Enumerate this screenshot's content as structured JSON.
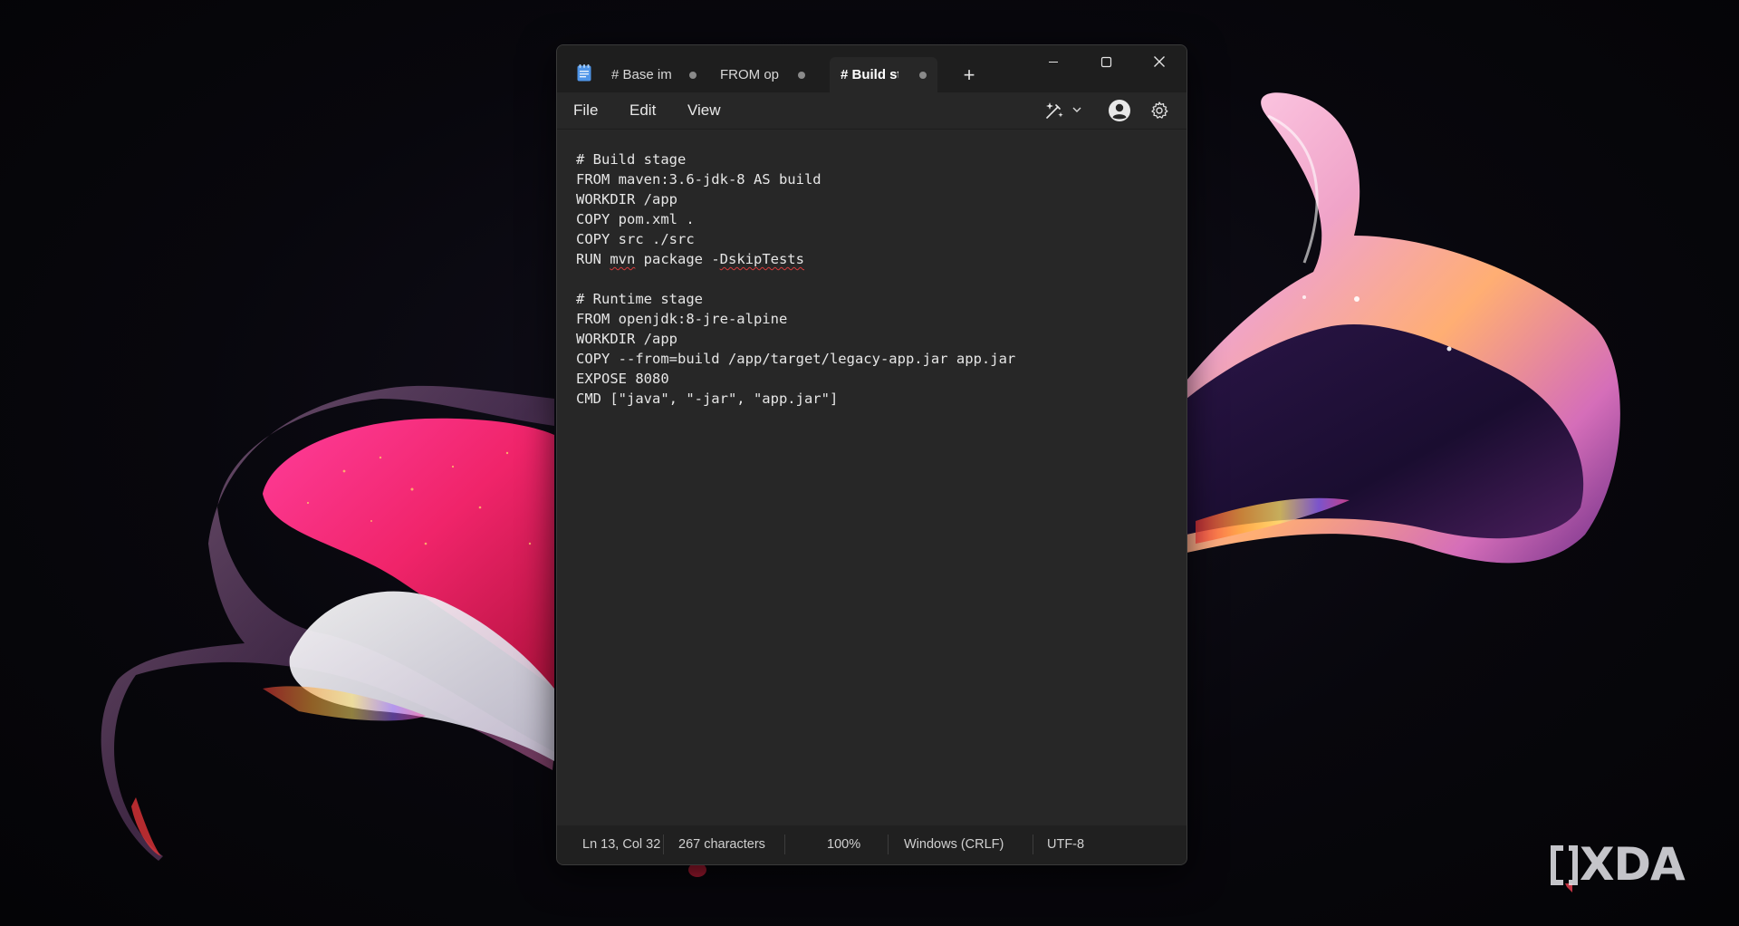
{
  "window": {
    "tabs": [
      {
        "label": "# Base im",
        "unsaved": true
      },
      {
        "label": "FROM op",
        "unsaved": true
      },
      {
        "label": "# Build st",
        "unsaved": true,
        "active": true
      }
    ],
    "new_tab_glyph": "+",
    "controls": {
      "minimize": "minimize-icon",
      "maximize": "maximize-icon",
      "close": "close-icon"
    }
  },
  "menu": {
    "file": "File",
    "edit": "Edit",
    "view": "View"
  },
  "toolbar": {
    "copilot_icon": "copilot-rewrite-icon",
    "dropdown_icon": "chevron-down-icon",
    "account_icon": "account-icon",
    "settings_icon": "settings-gear-icon"
  },
  "editor": {
    "lines": [
      {
        "text": "# Build stage"
      },
      {
        "text": "FROM maven:3.6-jdk-8 AS build"
      },
      {
        "text": "WORKDIR /app"
      },
      {
        "text": "COPY pom.xml ."
      },
      {
        "text": "COPY src ./src"
      },
      {
        "pre": "RUN ",
        "mis1": "mvn",
        "mid": " package -",
        "mis2": "DskipTests"
      },
      {
        "text": ""
      },
      {
        "text": "# Runtime stage"
      },
      {
        "text": "FROM openjdk:8-jre-alpine"
      },
      {
        "text": "WORKDIR /app"
      },
      {
        "text": "COPY --from=build /app/target/legacy-app.jar app.jar"
      },
      {
        "text": "EXPOSE 8080"
      },
      {
        "text": "CMD [\"java\", \"-jar\", \"app.jar\"]"
      }
    ]
  },
  "status": {
    "position": "Ln 13, Col 32",
    "characters": "267 characters",
    "zoom": "100%",
    "line_ending": "Windows (CRLF)",
    "encoding": "UTF-8"
  },
  "watermark": {
    "brand": "XDA"
  }
}
